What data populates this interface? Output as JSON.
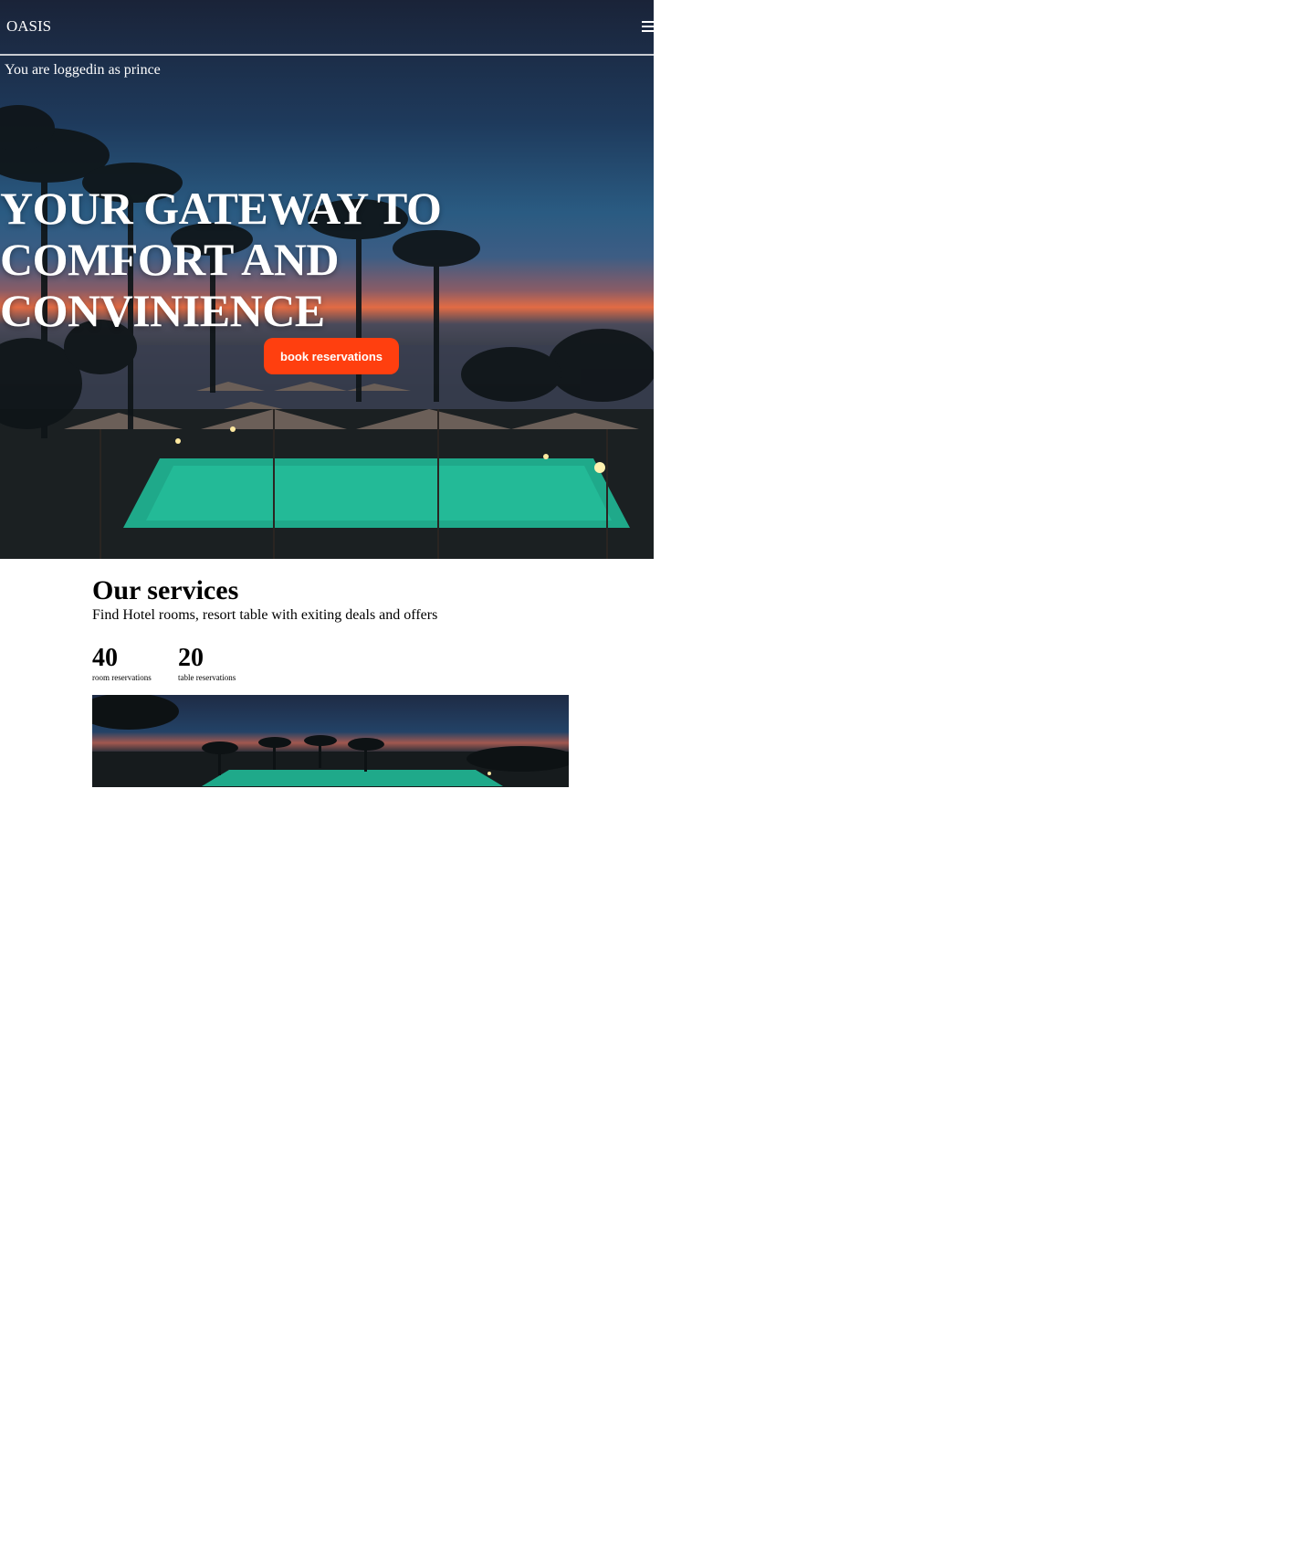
{
  "navbar": {
    "brand": "OASIS",
    "menu_icon": "hamburger-menu-icon"
  },
  "hero": {
    "login_note": "You are loggedin as prince",
    "headline": "YOUR GATEWAY TO COMFORT AND CONVINIENCE",
    "cta_label": "book reservations",
    "cta_color": "#ff3f0f",
    "background_description_icon": "resort-pool-palms-photo"
  },
  "services": {
    "title": "Our services",
    "subtitle": "Find Hotel rooms, resort table with exiting deals and offers",
    "stats": [
      {
        "value": "40",
        "label": "room reservations"
      },
      {
        "value": "20",
        "label": "table reservations"
      }
    ],
    "image_icon": "resort-panorama-photo"
  }
}
